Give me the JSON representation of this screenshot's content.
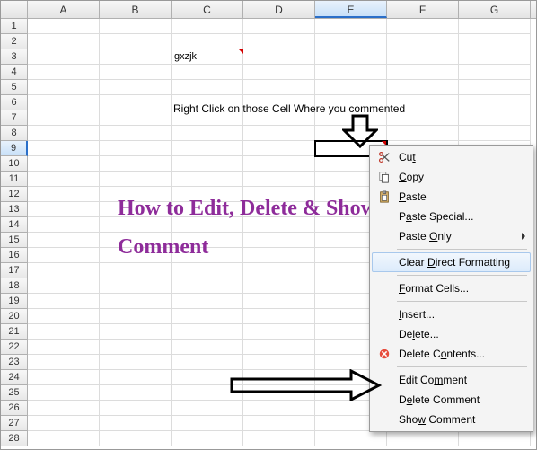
{
  "columns": [
    "A",
    "B",
    "C",
    "D",
    "E",
    "F",
    "G"
  ],
  "rows_count": 28,
  "active_col_index": 4,
  "active_row_index": 8,
  "cells": {
    "C3": "gxzjk"
  },
  "overlay": {
    "instruction": "Right Click on those Cell Where you commented",
    "title_html": "How to Edit, Delete & Show Comment"
  },
  "context_menu": {
    "items": [
      {
        "key": "cut",
        "label": "Cut",
        "icon": "scissors",
        "sep_after": false
      },
      {
        "key": "copy",
        "label": "Copy",
        "icon": "copy",
        "sep_after": false
      },
      {
        "key": "paste",
        "label": "Paste",
        "icon": "paste",
        "sep_after": false
      },
      {
        "key": "paste-special",
        "label": "Paste Special...",
        "icon": "",
        "sep_after": false
      },
      {
        "key": "paste-only",
        "label": "Paste Only",
        "icon": "",
        "submenu": true,
        "sep_after": true
      },
      {
        "key": "clear-format",
        "label": "Clear Direct Formatting",
        "icon": "",
        "hover": true,
        "sep_after": true
      },
      {
        "key": "format-cells",
        "label": "Format Cells...",
        "icon": "",
        "sep_after": true
      },
      {
        "key": "insert",
        "label": "Insert...",
        "icon": "",
        "sep_after": false
      },
      {
        "key": "delete",
        "label": "Delete...",
        "icon": "",
        "sep_after": false
      },
      {
        "key": "delete-contents",
        "label": "Delete Contents...",
        "icon": "delete",
        "sep_after": true
      },
      {
        "key": "edit-comment",
        "label": "Edit Comment",
        "icon": "",
        "sep_after": false
      },
      {
        "key": "delete-comment",
        "label": "Delete Comment",
        "icon": "",
        "sep_after": false
      },
      {
        "key": "show-comment",
        "label": "Show Comment",
        "icon": "",
        "sep_after": false
      }
    ]
  }
}
